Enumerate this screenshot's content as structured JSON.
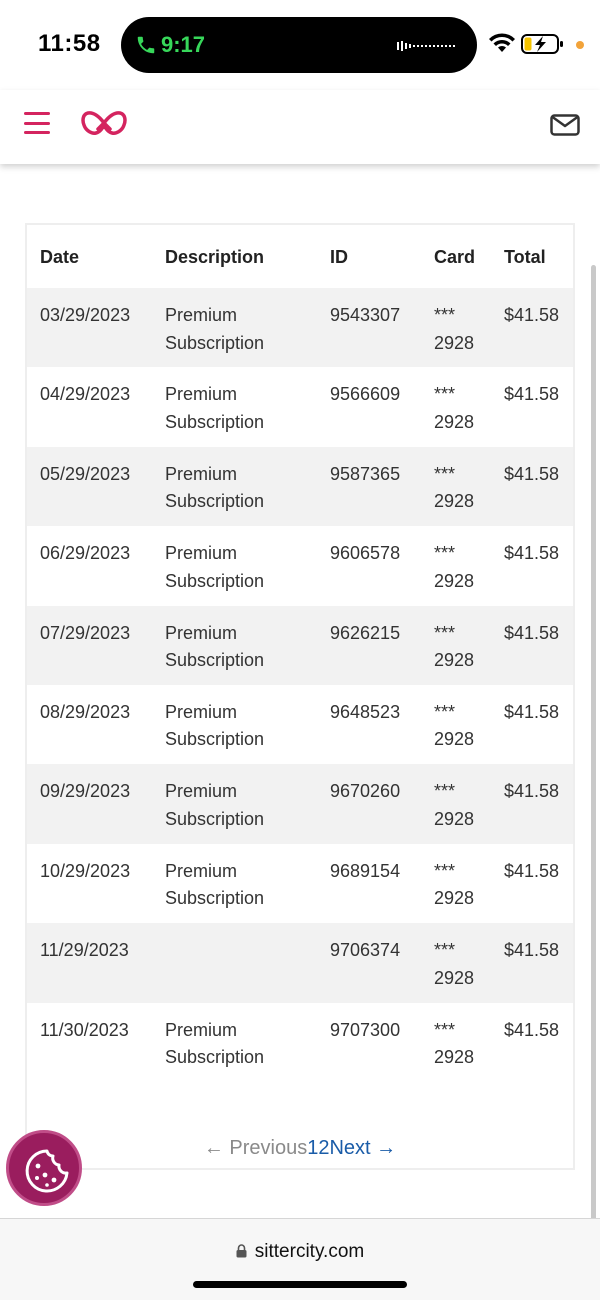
{
  "status_bar": {
    "time": "11:58",
    "call_time": "9:17"
  },
  "header": {
    "menu_icon": "hamburger-icon",
    "logo": "sittercity-logo",
    "mail_icon": "mail-icon",
    "brand_color": "#d4245f"
  },
  "table": {
    "headers": [
      "Date",
      "Description",
      "ID",
      "Card",
      "Total"
    ],
    "rows": [
      {
        "date": "03/29/2023",
        "desc1": "Premium",
        "desc2": "Subscription",
        "id": "9543307",
        "card1": "***",
        "card2": "2928",
        "total": "$41.58"
      },
      {
        "date": "04/29/2023",
        "desc1": "Premium",
        "desc2": "Subscription",
        "id": "9566609",
        "card1": "***",
        "card2": "2928",
        "total": "$41.58"
      },
      {
        "date": "05/29/2023",
        "desc1": "Premium",
        "desc2": "Subscription",
        "id": "9587365",
        "card1": "***",
        "card2": "2928",
        "total": "$41.58"
      },
      {
        "date": "06/29/2023",
        "desc1": "Premium",
        "desc2": "Subscription",
        "id": "9606578",
        "card1": "***",
        "card2": "2928",
        "total": "$41.58"
      },
      {
        "date": "07/29/2023",
        "desc1": "Premium",
        "desc2": "Subscription",
        "id": "9626215",
        "card1": "***",
        "card2": "2928",
        "total": "$41.58"
      },
      {
        "date": "08/29/2023",
        "desc1": "Premium",
        "desc2": "Subscription",
        "id": "9648523",
        "card1": "***",
        "card2": "2928",
        "total": "$41.58"
      },
      {
        "date": "09/29/2023",
        "desc1": "Premium",
        "desc2": "Subscription",
        "id": "9670260",
        "card1": "***",
        "card2": "2928",
        "total": "$41.58"
      },
      {
        "date": "10/29/2023",
        "desc1": "Premium",
        "desc2": "Subscription",
        "id": "9689154",
        "card1": "***",
        "card2": "2928",
        "total": "$41.58"
      },
      {
        "date": "11/29/2023",
        "desc1": "",
        "desc2": "",
        "id": "9706374",
        "card1": "***",
        "card2": "2928",
        "total": "$41.58"
      },
      {
        "date": "11/30/2023",
        "desc1": "Premium",
        "desc2": "Subscription",
        "id": "9707300",
        "card1": "***",
        "card2": "2928",
        "total": "$41.58"
      }
    ]
  },
  "pagination": {
    "previous": "← Previous",
    "page1": "1",
    "page2": "2",
    "next": "Next →"
  },
  "cookie_button": {
    "icon": "cookie-icon"
  },
  "browser": {
    "url": "sittercity.com",
    "lock_icon": "lock-icon"
  }
}
